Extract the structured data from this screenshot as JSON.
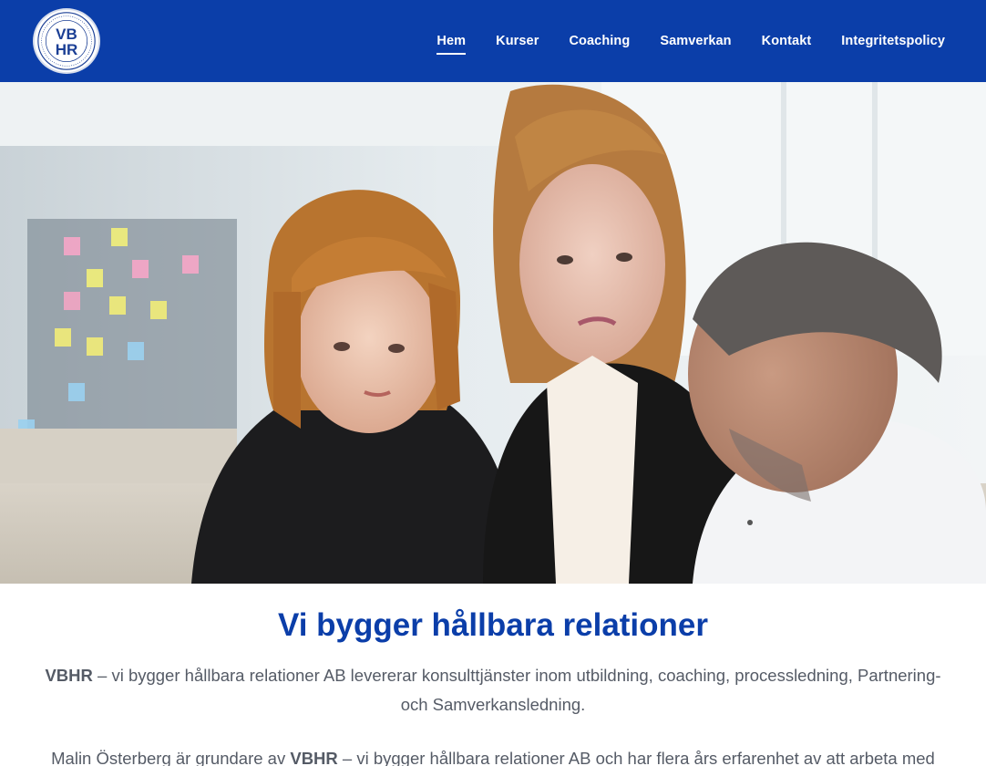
{
  "brand": {
    "logo_text_line1": "VB",
    "logo_text_line2": "HR",
    "primary_color": "#0b3ea9"
  },
  "nav": {
    "items": [
      {
        "label": "Hem",
        "active": true
      },
      {
        "label": "Kurser",
        "active": false
      },
      {
        "label": "Coaching",
        "active": false
      },
      {
        "label": "Samverkan",
        "active": false
      },
      {
        "label": "Kontakt",
        "active": false
      },
      {
        "label": "Integritetspolicy",
        "active": false
      }
    ]
  },
  "hero": {
    "image_icon": "team-meeting-photo"
  },
  "main": {
    "headline": "Vi bygger hållbara relationer",
    "intro_brand": "VBHR",
    "intro_text": " – vi bygger hållbara relationer AB levererar konsulttjänster inom utbildning, coaching, processledning, Partnering- och Samverkansledning.",
    "body_prefix": "Malin Österberg är grundare av ",
    "body_brand": "VBHR",
    "body_text": " – vi bygger hållbara relationer AB och har flera års erfarenhet av att arbeta med"
  }
}
